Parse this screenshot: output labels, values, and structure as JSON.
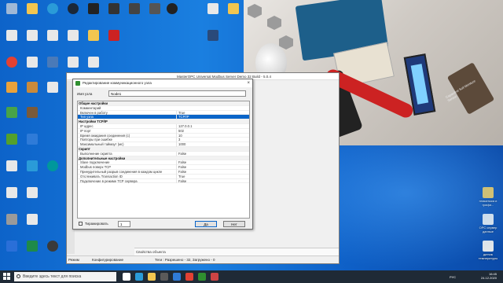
{
  "desktop": {
    "icons_left": [
      {
        "label": "",
        "icon": "recycle-bin-icon",
        "color": "#9fb8d6"
      },
      {
        "label": "",
        "icon": "folder-icon",
        "color": "#f2c650"
      },
      {
        "label": "",
        "icon": "edge-icon",
        "color": "#2a9bd8"
      },
      {
        "label": "",
        "icon": "steam-icon",
        "color": "#1b2838"
      },
      {
        "label": "",
        "icon": "monitor-icon",
        "color": "#222222"
      },
      {
        "label": "",
        "icon": "terminal-icon",
        "color": "#333333"
      },
      {
        "label": "",
        "icon": "obs-icon",
        "color": "#222222"
      },
      {
        "label": "",
        "icon": "document-icon",
        "color": "#e8e8e8"
      },
      {
        "label": "",
        "icon": "folder-icon",
        "color": "#f2c650"
      }
    ],
    "icons_right": [
      {
        "label": "плакатыка и графи...",
        "icon": "folder-icon",
        "color": "#f2c650"
      },
      {
        "label": "ОРС сервер данные",
        "icon": "document-icon",
        "color": "#e8e8e8"
      },
      {
        "label": "датчик температуры",
        "icon": "document-icon",
        "color": "#e8e8e8"
      }
    ]
  },
  "photo": {
    "sensor_caption": "Capacitive Soil Moisture Sensor"
  },
  "app_window": {
    "title": "MasterOPC Universal Modbus Server Demo 32 Build - 5.0.4",
    "object_properties_label": "Свойства объекта",
    "status_mode": "Режим",
    "status_config": "Конфигурирование",
    "status_tags": "Теги : Разрешено - 32, Загружено - 0"
  },
  "dialog": {
    "title": "Редактирование коммуникационного узла",
    "name_label": "Имя узла",
    "name_value": "Node1",
    "rows": [
      {
        "type": "category",
        "key": "Общие настройки",
        "value": ""
      },
      {
        "type": "prop",
        "key": "Комментарий",
        "value": ""
      },
      {
        "type": "prop",
        "key": "Включен в работу",
        "value": "True"
      },
      {
        "type": "selected",
        "key": "Тип узла",
        "value": "TCP/IP"
      },
      {
        "type": "category",
        "key": "Настройки TCP/IP",
        "value": ""
      },
      {
        "type": "prop",
        "key": "IP адрес",
        "value": "127.0.0.1"
      },
      {
        "type": "prop",
        "key": "IP порт",
        "value": "502"
      },
      {
        "type": "prop",
        "key": "Время ожидания соединения (с)",
        "value": "10"
      },
      {
        "type": "prop",
        "key": "Повторы при ошибке",
        "value": "3"
      },
      {
        "type": "prop",
        "key": "Максимальный таймаут (мс)",
        "value": "1000"
      },
      {
        "type": "category",
        "key": "Скрипт",
        "value": ""
      },
      {
        "type": "prop",
        "key": "Выполнение скрипта",
        "value": "False"
      },
      {
        "type": "category",
        "key": "Дополнительные настройки",
        "value": ""
      },
      {
        "type": "prop",
        "key": "Slave подключение",
        "value": "False"
      },
      {
        "type": "prop",
        "key": "Modbus поверх TCP",
        "value": "False"
      },
      {
        "type": "prop",
        "key": "Принудительный разрыв соединения в каждом цикле",
        "value": "False"
      },
      {
        "type": "prop",
        "key": "Отслеживать Transaction ID",
        "value": "True"
      },
      {
        "type": "prop",
        "key": "Подключение в режиме TCP сервера",
        "value": "False"
      }
    ],
    "replicate_label": "Тиражировать",
    "replicate_count": "1",
    "ok_label": "Да",
    "cancel_label": "Нет"
  },
  "taskbar": {
    "search_placeholder": "Введите здесь текст для поиска",
    "lang": "РУС",
    "time": "16:45",
    "date": "24.12.2020",
    "pinned": [
      {
        "icon": "task-view-icon",
        "color": "#ffffff"
      },
      {
        "icon": "edge-icon",
        "color": "#2a9bd8"
      },
      {
        "icon": "file-explorer-icon",
        "color": "#f2c650"
      },
      {
        "icon": "store-icon",
        "color": "#5a5a5a"
      },
      {
        "icon": "mail-icon",
        "color": "#2f7bd8"
      },
      {
        "icon": "chrome-icon",
        "color": "#e34133"
      },
      {
        "icon": "app-icon",
        "color": "#2f8f2f"
      },
      {
        "icon": "app-icon",
        "color": "#c44"
      }
    ]
  }
}
